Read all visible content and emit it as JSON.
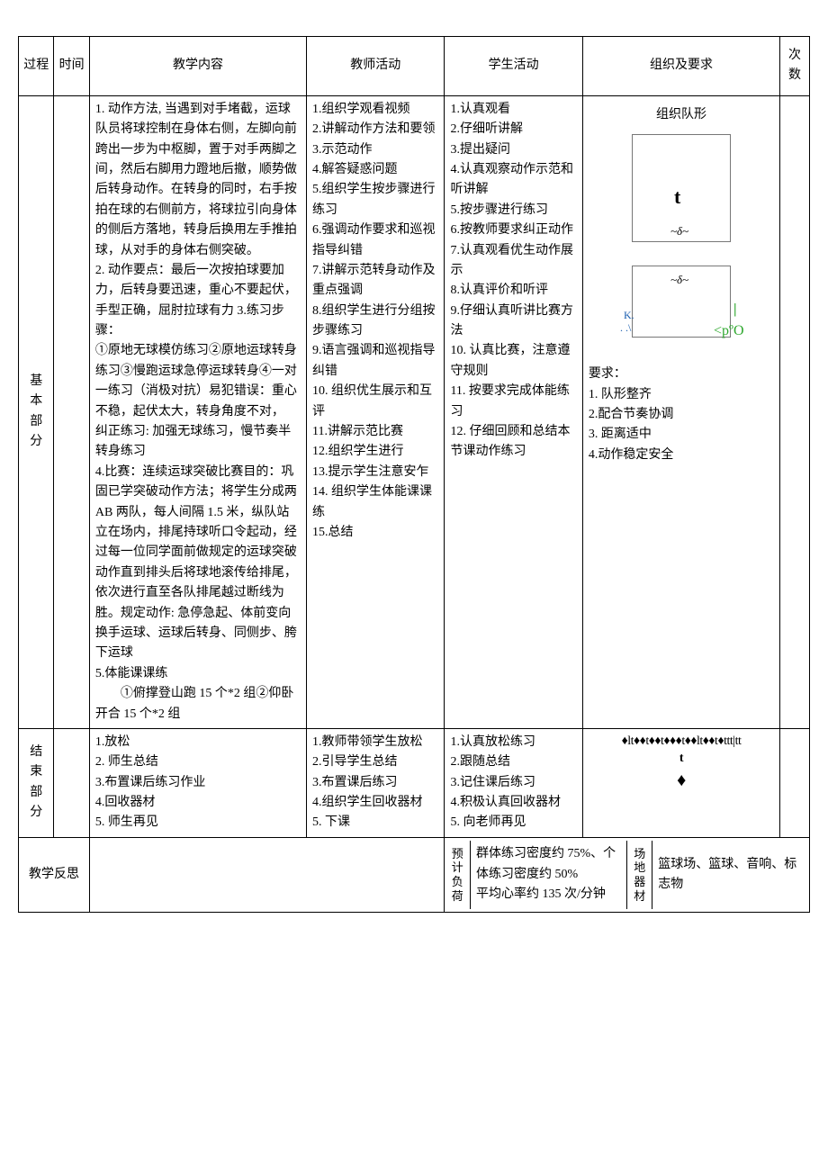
{
  "headers": {
    "process": "过程",
    "time": "时间",
    "content": "教学内容",
    "teacher": "教师活动",
    "student": "学生活动",
    "org": "组织及要求",
    "count": "次数"
  },
  "row_basic": {
    "process": "基 本部分",
    "content": "1. 动作方法, 当遇到对手堵截，运球队员将球控制在身体右侧，左脚向前跨出一步为中枢脚，置于对手两脚之间，然后右脚用力蹬地后撤，顺势做后转身动作。在转身的同时，右手按拍在球的右侧前方，将球拉引向身体的侧后方落地，转身后换用左手推拍球，从对手的身体右侧突破。\n2. 动作要点：最后一次按拍球要加力，后转身要迅速，重心不要起伏，手型正确，屈肘拉球有力 3.练习步骤：\n①原地无球模仿练习②原地运球转身练习③慢跑运球急停运球转身④一对一练习（消极对抗）易犯错误：重心不稳，起伏太大，转身角度不对，\n纠正练习: 加强无球练习，慢节奏半转身练习\n4.比赛：连续运球突破比赛目的：巩固已学突破动作方法；将学生分成两AB 两队，每人间隔 1.5 米，纵队站立在场内，排尾持球听口令起动，经过每一位同学面前做规定的运球突破动作直到排头后将球地滚传给排尾，依次进行直至各队排尾越过断线为胜。规定动作: 急停急起、体前变向换手运球、运球后转身、同侧步、胯下运球\n5.体能课课练\n        ①俯撑登山跑 15 个*2 组②仰卧开合 15 个*2 组",
    "teacher": "1.组织学观看视频\n2.讲解动作方法和要领\n3.示范动作\n4.解答疑惑问题\n5.组织学生按步骤进行练习\n6.强调动作要求和巡视指导纠错\n7.讲解示范转身动作及重点强调\n8.组织学生进行分组按步骤练习\n9.语言强调和巡视指导纠错\n10. 组织优生展示和互评\n11.讲解示范比赛\n12.组织学生进行\n13.提示学生注意安乍\n14. 组织学生体能课课练\n15.总结",
    "student": "1.认真观看\n2.仔细听讲解\n3.提出疑问\n4.认真观察动作示范和听讲解\n5.按步骤进行练习\n6.按教师要求纠正动作\n7.认真观看优生动作展示\n8.认真评价和听评\n9.仔细认真听讲比赛方法\n10. 认真比赛，注意遵守规则\n11. 按要求完成体能练习\n12. 仔细回顾和总结本节课动作练习",
    "org_title": "组织队形",
    "org_marks": {
      "t": "t",
      "delta": "~δ~",
      "k": "K.",
      "dots": ". .\\",
      "bar": "|",
      "poo": "<pºO"
    },
    "org_req_label": "要求：",
    "org_req": "1. 队形整齐\n2.配合节奏协调\n3. 距离适中\n4.动作稳定安全"
  },
  "row_end": {
    "process": "结 束部分",
    "content": "1.放松\n2. 师生总结\n3.布置课后练习作业\n4.回收器材\n5. 师生再见",
    "teacher": "1.教师带领学生放松\n2.引导学生总结\n3.布置课后练习\n4.组织学生回收器材\n5. 下课",
    "student": "1.认真放松练习\n2.跟随总结\n3.记住课后练习\n4.积极认真回收器材\n5. 向老师再见",
    "org_symbols_line1": "♦lt♦♦t♦♦t♦♦♦t♦♦lt♦♦t♦ttt|tt",
    "org_symbols_line2": "t",
    "org_symbols_line3": "♦"
  },
  "footer": {
    "reflect": "教学反思",
    "load_label": "预计负荷",
    "load_text": "群体练习密度约 75%、个体练习密度约 50%\n平均心率约 135 次/分钟",
    "equip_label": "场地器材",
    "equip_text": "篮球场、篮球、音响、标志物"
  }
}
